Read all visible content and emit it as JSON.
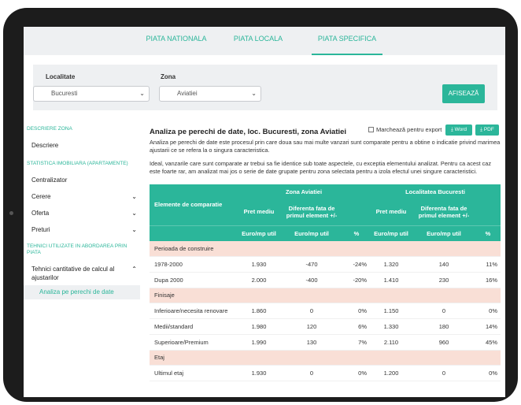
{
  "tabs": [
    {
      "label": "PIATA NATIONALA"
    },
    {
      "label": "PIATA LOCALA"
    },
    {
      "label": "PIATA SPECIFICA"
    }
  ],
  "filters": {
    "localitate_label": "Localitate",
    "localitate_value": "Bucuresti",
    "zona_label": "Zona",
    "zona_value": "Aviatiei",
    "afiseaza": "AFISEAZĂ"
  },
  "sidebar": {
    "sec1": "DESCRIERE ZONA",
    "descriere": "Descriere",
    "sec2": "STATISTICA IMOBILIARA (APARTAMENTE)",
    "centralizator": "Centralizator",
    "cerere": "Cerere",
    "oferta": "Oferta",
    "preturi": "Preturi",
    "sec3": "TEHNICI UTILIZATE IN ABORDAREA PRIN PIATA",
    "tehnici": "Tehnici cantitative de calcul al ajustarilor",
    "analiza": "Analiza pe perechi de date"
  },
  "content": {
    "title": "Analiza pe perechi de date, loc. Bucuresti, zona Aviatiei",
    "mark_export": "Marchează pentru export",
    "word": "Word",
    "pdf": "PDF",
    "para1": "Analiza pe perechi de date este procesul prin care doua sau mai multe vanzari sunt comparate pentru a obtine o indicatie privind marimea ajustarii ce se refera la o singura caracteristica.",
    "para2": "Ideal, vanzarile care sunt comparate ar trebui sa fie identice sub toate aspectele, cu exceptia elementului analizat. Pentru ca acest caz este foarte rar, am analizat mai jos o serie de date grupate pentru zona selectata pentru a izola efectul unei singure caracteristici."
  },
  "table": {
    "col_elements": "Elemente de comparatie",
    "zona_group": "Zona Aviatiei",
    "loc_group": "Localitatea Bucuresti",
    "pret_mediu": "Pret mediu",
    "diferenta": "Diferenta fata de primul element +/-",
    "unit_euro": "Euro/mp util",
    "unit_pct": "%",
    "groups": [
      {
        "name": "Perioada de construire",
        "rows": [
          {
            "label": "1978-2000",
            "z_price": "1.930",
            "z_diff": "-470",
            "z_pct": "-24%",
            "l_price": "1.320",
            "l_diff": "140",
            "l_pct": "11%"
          },
          {
            "label": "Dupa 2000",
            "z_price": "2.000",
            "z_diff": "-400",
            "z_pct": "-20%",
            "l_price": "1.410",
            "l_diff": "230",
            "l_pct": "16%"
          }
        ]
      },
      {
        "name": "Finisaje",
        "rows": [
          {
            "label": "Inferioare/necesita renovare",
            "z_price": "1.860",
            "z_diff": "0",
            "z_pct": "0%",
            "l_price": "1.150",
            "l_diff": "0",
            "l_pct": "0%"
          },
          {
            "label": "Medii/standard",
            "z_price": "1.980",
            "z_diff": "120",
            "z_pct": "6%",
            "l_price": "1.330",
            "l_diff": "180",
            "l_pct": "14%"
          },
          {
            "label": "Superioare/Premium",
            "z_price": "1.990",
            "z_diff": "130",
            "z_pct": "7%",
            "l_price": "2.110",
            "l_diff": "960",
            "l_pct": "45%"
          }
        ]
      },
      {
        "name": "Etaj",
        "rows": [
          {
            "label": "Ultimul etaj",
            "z_price": "1.930",
            "z_diff": "0",
            "z_pct": "0%",
            "l_price": "1.200",
            "l_diff": "0",
            "l_pct": "0%"
          }
        ]
      }
    ]
  },
  "colors": {
    "accent": "#2bb69a",
    "group_bg": "#f9dfd6",
    "panel_bg": "#eef0f2"
  }
}
